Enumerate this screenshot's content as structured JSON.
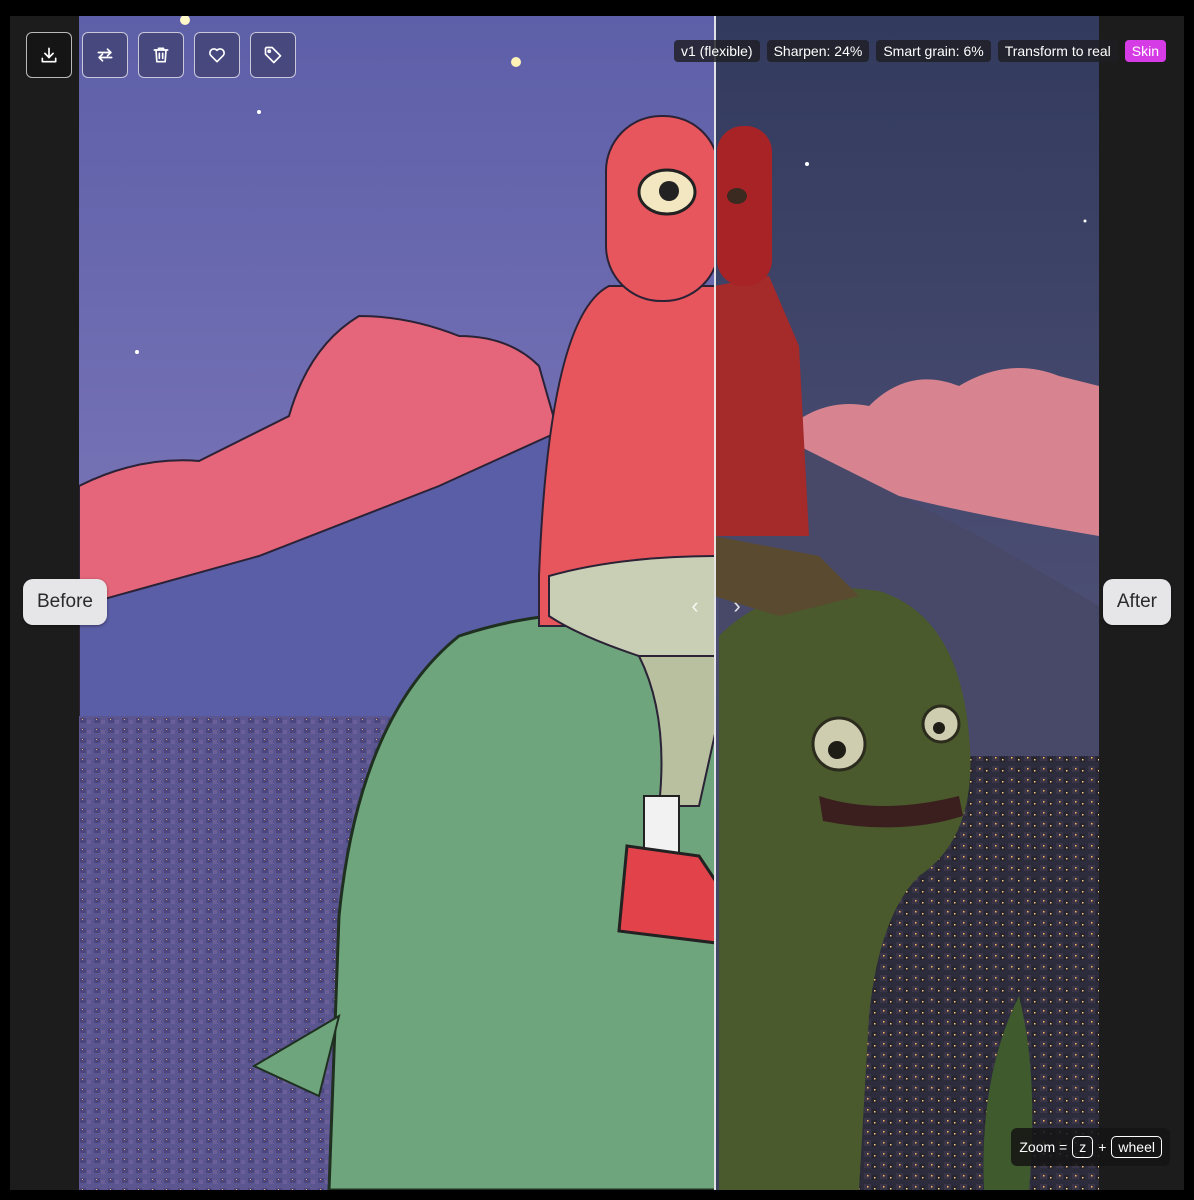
{
  "toolbar": {
    "buttons": [
      {
        "icon": "download-icon"
      },
      {
        "icon": "swap-icon"
      },
      {
        "icon": "trash-icon"
      },
      {
        "icon": "heart-icon"
      },
      {
        "icon": "tag-icon"
      }
    ]
  },
  "tags": {
    "version": "v1 (flexible)",
    "sharpen": "Sharpen: 24%",
    "grain": "Smart grain: 6%",
    "transform": "Transform to real",
    "skin": "Skin"
  },
  "compare": {
    "before_label": "Before",
    "after_label": "After",
    "split_position": 0.62
  },
  "hint": {
    "prefix": "Zoom =",
    "key": "z",
    "plus": "+",
    "modifier": "wheel"
  },
  "colors": {
    "accent": "#d63ce6",
    "before_sky": "#6f72b4",
    "after_sky": "#3c4468"
  }
}
